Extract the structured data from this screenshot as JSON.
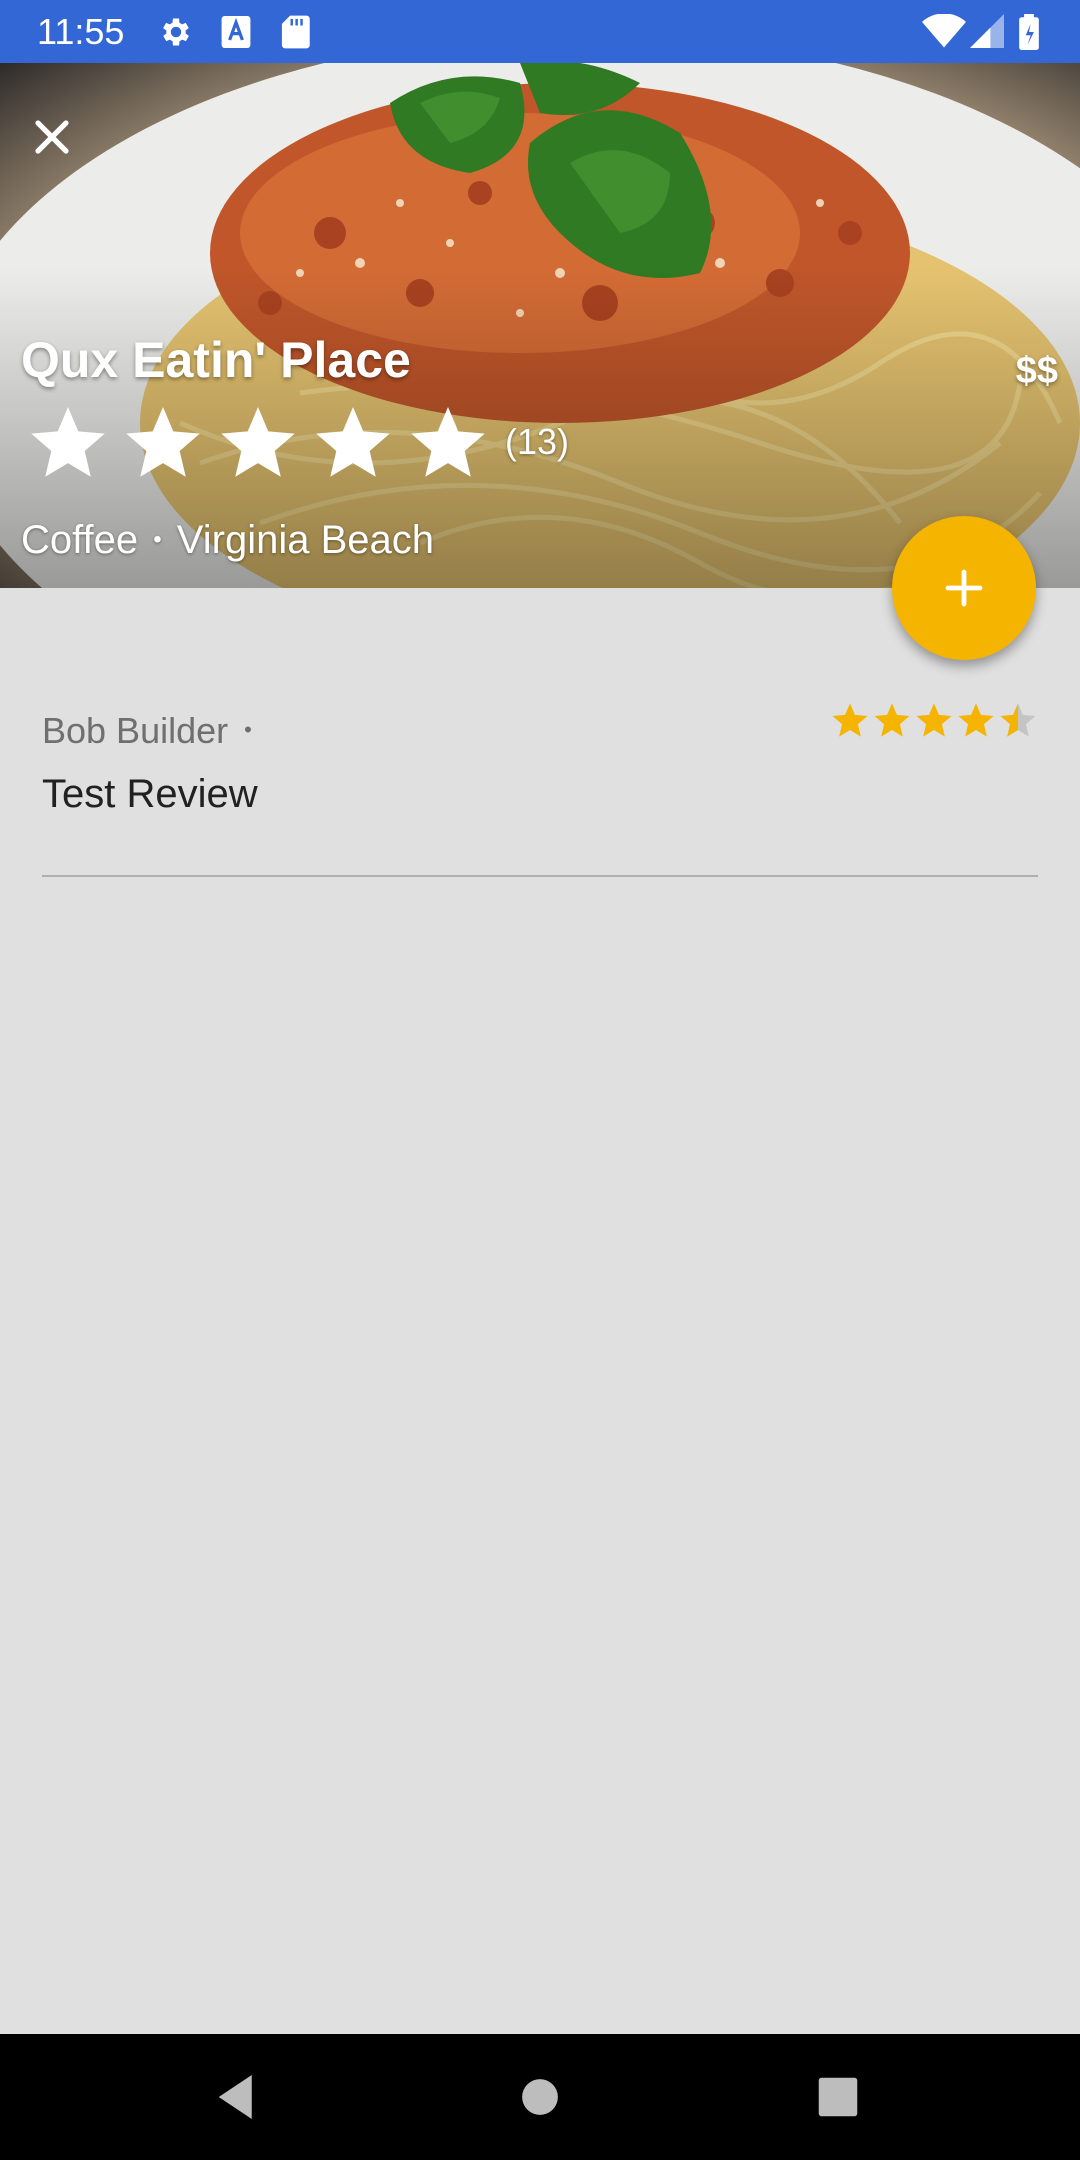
{
  "status_bar": {
    "time": "11:55",
    "icons": [
      "gear-icon",
      "text-a-icon",
      "sd-card-icon",
      "wifi-icon",
      "signal-icon",
      "battery-icon"
    ]
  },
  "restaurant": {
    "name": "Qux Eatin' Place",
    "price": "$$",
    "rating": 5,
    "rating_max": 5,
    "review_count": "(13)",
    "category": "Coffee",
    "separator": "•",
    "city": "Virginia Beach"
  },
  "reviews": [
    {
      "author": "Bob Builder",
      "separator": "•",
      "text": "Test Review",
      "rating": 4.5,
      "rating_max": 5
    }
  ],
  "colors": {
    "status_bar": "#3367d6",
    "accent": "#f4b400",
    "background": "#e0e0e0",
    "nav_bar": "#000000"
  },
  "icons": {
    "close": "close-icon",
    "add": "plus-icon",
    "nav": [
      "back-icon",
      "home-icon",
      "recents-icon"
    ]
  }
}
